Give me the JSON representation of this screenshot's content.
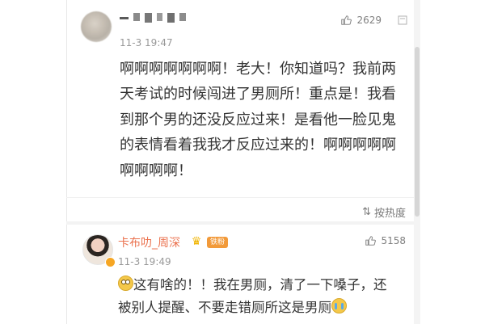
{
  "comments": [
    {
      "username": "",
      "username_obscured": true,
      "time": "11-3 19:47",
      "likes": "2629",
      "text": "啊啊啊啊啊啊啊！老大！你知道吗？我前两天考试的时候闯进了男厕所！重点是！我看到那个男的还没反应过来！是看他一脸见鬼的表情看着我我才反应过来的！啊啊啊啊啊啊啊啊啊！"
    },
    {
      "username": "卡布叻_周深",
      "vip_badge": "铁粉",
      "time": "11-3 19:49",
      "likes": "5158",
      "text_part1": "这有啥的！！我在男厕，清了一下嗓子，还被别人提醒、不要走错厕所这是男厕"
    }
  ],
  "fold": {
    "label": "按热度"
  },
  "icons": {
    "like": "thumbs-up-icon",
    "more": "more-vert-icon",
    "sort": "sort-icon",
    "crown": "crown-icon",
    "emoji_roll": "eye-roll-emoji-icon",
    "emoji_cry": "crying-emoji-icon",
    "avatar": "user-avatar-icon"
  },
  "colors": {
    "username_highlight": "#eb7350",
    "muted": "#999999",
    "body": "#333333",
    "badge": "#f29a3a"
  }
}
